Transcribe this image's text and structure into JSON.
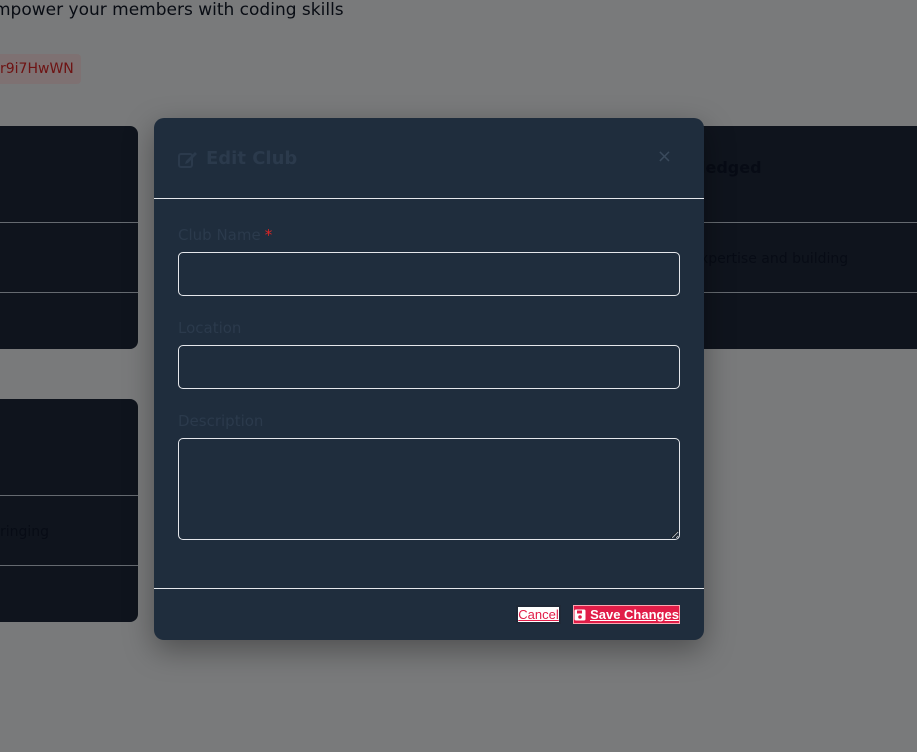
{
  "background": {
    "tagline": "mpower your members with coding skills",
    "invite_code": "r9i7HwWN",
    "card_b_title": "ledged",
    "card_b_text": "xpertise and building",
    "card_c_text": "ringing"
  },
  "modal": {
    "title": "Edit Club",
    "close_glyph": "×",
    "fields": {
      "club_name": {
        "label": "Club Name",
        "required_mark": "*",
        "value": "",
        "placeholder": ""
      },
      "location": {
        "label": "Location",
        "value": "",
        "placeholder": ""
      },
      "description": {
        "label": "Description",
        "value": "",
        "placeholder": ""
      }
    },
    "buttons": {
      "cancel": "Cancel",
      "save": "Save Changes"
    },
    "icons": {
      "title_icon": "edit-icon",
      "save_icon": "floppy-disk-icon",
      "close_icon": "close-icon"
    }
  },
  "colors": {
    "modal_bg": "#1f2d3d",
    "accent": "#e11d48",
    "overlay": "rgba(0,0,0,0.5)"
  }
}
